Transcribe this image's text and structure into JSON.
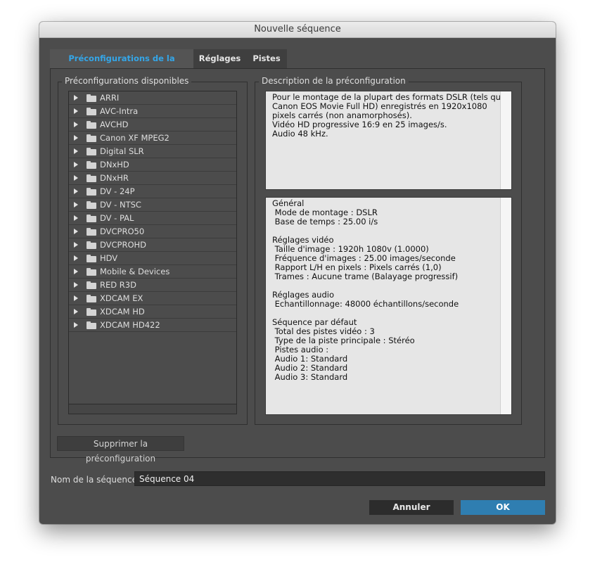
{
  "window": {
    "title": "Nouvelle séquence"
  },
  "tabs": [
    {
      "label": "Préconfigurations de la séquence",
      "active": true
    },
    {
      "label": "Réglages",
      "active": false
    },
    {
      "label": "Pistes",
      "active": false
    }
  ],
  "presets": {
    "legend": "Préconfigurations disponibles",
    "items": [
      "ARRI",
      "AVC-Intra",
      "AVCHD",
      "Canon XF MPEG2",
      "Digital SLR",
      "DNxHD",
      "DNxHR",
      "DV - 24P",
      "DV - NTSC",
      "DV - PAL",
      "DVCPRO50",
      "DVCPROHD",
      "HDV",
      "Mobile & Devices",
      "RED R3D",
      "XDCAM EX",
      "XDCAM HD",
      "XDCAM HD422"
    ]
  },
  "description": {
    "legend": "Description de la préconfiguration",
    "summary": "Pour le montage de la plupart des formats DSLR (tels que\nCanon EOS Movie Full HD) enregistrés en 1920x1080\npixels carrés (non anamorphosés).\nVidéo HD progressive 16:9 en 25 images/s.\nAudio 48 kHz.",
    "details": "Général\n Mode de montage : DSLR\n Base de temps : 25.00 i/s\n\nRéglages vidéo\n Taille d'image : 1920h 1080v (1.0000)\n Fréquence d'images : 25.00 images/seconde\n Rapport L/H en pixels : Pixels carrés (1,0)\n Trames : Aucune trame (Balayage progressif)\n\nRéglages audio\n Echantillonnage: 48000 échantillons/seconde\n\nSéquence par défaut\n Total des pistes vidéo : 3\n Type de la piste principale : Stéréo\n Pistes audio :\n Audio 1: Standard\n Audio 2: Standard\n Audio 3: Standard"
  },
  "buttons": {
    "delete_preset": "Supprimer la préconfiguration",
    "cancel": "Annuler",
    "ok": "OK"
  },
  "sequence_name": {
    "label": "Nom de la séquence :",
    "value": "Séquence 04"
  },
  "colors": {
    "accent_tab": "#34a6e8",
    "ok_button": "#2f7eb1",
    "dialog_bg": "#4c4c4c"
  },
  "icons": {
    "tree_expander": "triangle-right-icon",
    "tree_item": "folder-icon"
  }
}
